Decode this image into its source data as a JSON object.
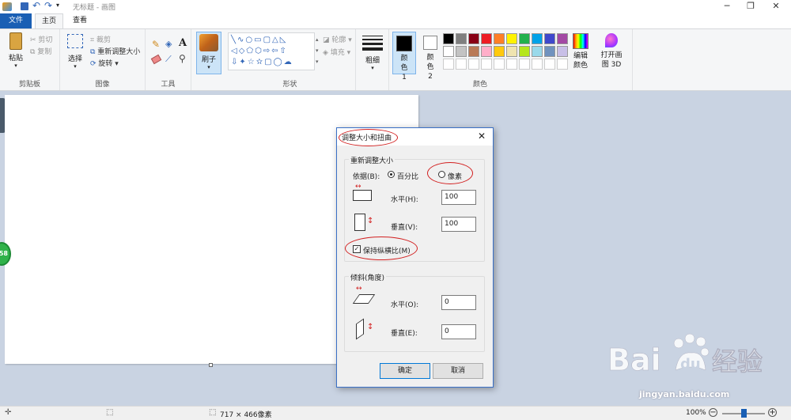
{
  "window": {
    "title": "无标题 - 画图",
    "minimize": "─",
    "maximize": "❐",
    "close": "✕"
  },
  "tabs": {
    "file": "文件",
    "home": "主页",
    "view": "查看"
  },
  "ribbon": {
    "clipboard": {
      "paste": "粘贴",
      "cut": "剪切",
      "copy": "复制",
      "group": "剪贴板"
    },
    "image": {
      "select": "选择",
      "crop": "裁剪",
      "resize": "重新调整大小",
      "rotate": "旋转",
      "group": "图像"
    },
    "tools": {
      "group": "工具"
    },
    "brush": {
      "label": "刷子"
    },
    "shapes": {
      "outline": "轮廓",
      "fill": "填充",
      "group": "形状"
    },
    "size": {
      "label": "粗细"
    },
    "colors": {
      "color1": "颜色 1",
      "color2": "颜色 2",
      "edit": "编辑颜色",
      "paint3d": "打开画图 3D",
      "group": "颜色",
      "palette_row1": [
        "#000000",
        "#7f7f7f",
        "#880015",
        "#ed1c24",
        "#ff7f27",
        "#fff200",
        "#22b14c",
        "#00a2e8",
        "#3f48cc",
        "#a349a4"
      ],
      "palette_row2": [
        "#ffffff",
        "#c3c3c3",
        "#b97a57",
        "#ffaec9",
        "#ffc90e",
        "#efe4b0",
        "#b5e61d",
        "#99d9ea",
        "#7092be",
        "#c8bfe7"
      ]
    }
  },
  "dialog": {
    "title": "调整大小和扭曲",
    "resize_section": "重新调整大小",
    "by_label": "依据(B):",
    "percent": "百分比",
    "pixels": "像素",
    "horizontal_label": "水平(H):",
    "horizontal_value": "100",
    "vertical_label": "垂直(V):",
    "vertical_value": "100",
    "keep_ratio": "保持纵横比(M)",
    "skew_section": "倾斜(角度)",
    "skew_h_label": "水平(O):",
    "skew_h_value": "0",
    "skew_v_label": "垂直(E):",
    "skew_v_value": "0",
    "ok": "确定",
    "cancel": "取消"
  },
  "statusbar": {
    "size": "717 × 466像素",
    "zoom": "100%",
    "zoom_level": 0.5
  },
  "badge": {
    "text": "58"
  },
  "watermark": {
    "url": "jingyan.baidu.com"
  }
}
